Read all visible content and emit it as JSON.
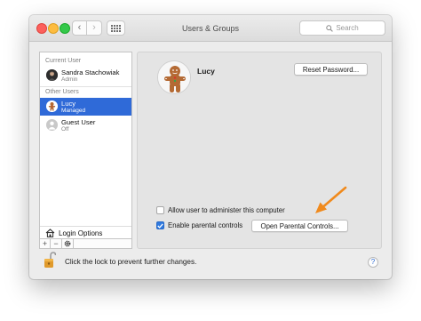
{
  "window": {
    "title": "Users & Groups"
  },
  "toolbar": {
    "back_glyph": "‹",
    "forward_glyph": "›",
    "grid_icon": "grid-icon"
  },
  "search": {
    "placeholder": "Search"
  },
  "sidebar": {
    "current_user_header": "Current User",
    "current_user": {
      "name": "Sandra Stachowiak",
      "role": "Admin"
    },
    "other_users_header": "Other Users",
    "other_users": [
      {
        "name": "Lucy",
        "role": "Managed",
        "selected": true
      },
      {
        "name": "Guest User",
        "role": "Off",
        "selected": false
      }
    ],
    "login_options_label": "Login Options",
    "tools": {
      "add": "+",
      "remove": "−",
      "action": "gear-icon"
    }
  },
  "main": {
    "user_name": "Lucy",
    "reset_password_label": "Reset Password...",
    "allow_admin_label": "Allow user to administer this computer",
    "allow_admin_checked": false,
    "parental_controls_label": "Enable parental controls",
    "parental_controls_checked": true,
    "open_parental_label": "Open Parental Controls..."
  },
  "footer": {
    "lock_text": "Click the lock to prevent further changes.",
    "help_glyph": "?"
  },
  "colors": {
    "selection": "#2f6ad8",
    "checkbox_checked": "#2f7ae0",
    "arrow": "#f08a1d",
    "lock": "#e09a2c"
  }
}
